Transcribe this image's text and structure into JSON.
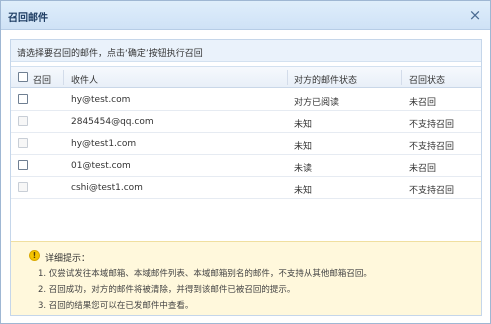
{
  "dialog": {
    "title": "召回邮件",
    "close_glyph": "×"
  },
  "instruction": "请选择要召回的邮件，点击‘确定’按钮执行召回",
  "table": {
    "headers": {
      "select": "召回",
      "recipient": "收件人",
      "their_status": "对方的邮件状态",
      "recall_status": "召回状态"
    },
    "rows": [
      {
        "recipient": "hy@test.com",
        "their_status": "对方已阅读",
        "recall_status": "未召回",
        "selectable": true
      },
      {
        "recipient": "2845454@qq.com",
        "their_status": "未知",
        "recall_status": "不支持召回",
        "selectable": false
      },
      {
        "recipient": "hy@test1.com",
        "their_status": "未知",
        "recall_status": "不支持召回",
        "selectable": false
      },
      {
        "recipient": "01@test.com",
        "their_status": "未读",
        "recall_status": "未召回",
        "selectable": true
      },
      {
        "recipient": "cshi@test1.com",
        "their_status": "未知",
        "recall_status": "不支持召回",
        "selectable": false
      }
    ]
  },
  "tips": {
    "icon": "exclamation-icon",
    "title": "详细提示：",
    "lines": [
      "1. 仅尝试发往本域邮箱、本域邮件列表、本域邮箱别名的邮件，不支持从其他邮箱召回。",
      "2. 召回成功，对方的邮件将被清除，并得到该邮件已被召回的提示。",
      "3. 召回的结果您可以在已发邮件中查看。"
    ]
  }
}
